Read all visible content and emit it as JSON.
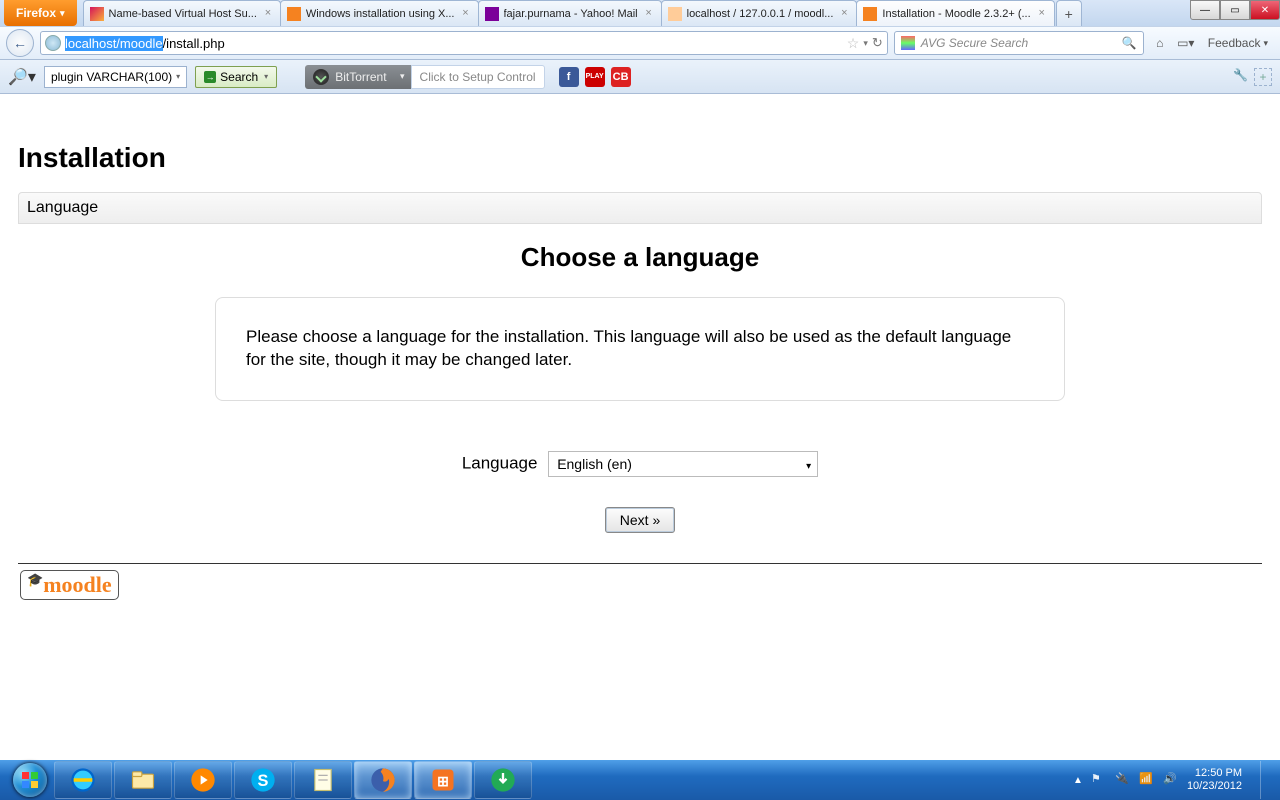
{
  "browser": {
    "name": "Firefox",
    "tabs": [
      {
        "title": "Name-based Virtual Host Su...",
        "favicon": "fv-apache"
      },
      {
        "title": "Windows installation using X...",
        "favicon": "fv-moodle"
      },
      {
        "title": "fajar.purnama - Yahoo! Mail",
        "favicon": "fv-yahoo"
      },
      {
        "title": "localhost / 127.0.0.1 / moodl...",
        "favicon": "fv-pma"
      },
      {
        "title": "Installation - Moodle 2.3.2+ (...",
        "favicon": "fv-moodle",
        "active": true
      }
    ],
    "url_selected": "localhost/moodle",
    "url_rest": "/install.php",
    "search_placeholder": "AVG Secure Search",
    "feedback": "Feedback"
  },
  "toolbar": {
    "plugin_text": "plugin VARCHAR(100)",
    "search_label": "Search",
    "bt_label": "BitTorrent",
    "setup_placeholder": "Click to Setup Control"
  },
  "page": {
    "h1": "Installation",
    "section_header": "Language",
    "h2": "Choose a language",
    "info_text": "Please choose a language for the installation. This language will also be used as the default language for the site, though it may be changed later.",
    "lang_label": "Language",
    "lang_value": "English (en)",
    "next_label": "Next »",
    "logo_text": "moodle"
  },
  "system": {
    "time": "12:50 PM",
    "date": "10/23/2012"
  }
}
